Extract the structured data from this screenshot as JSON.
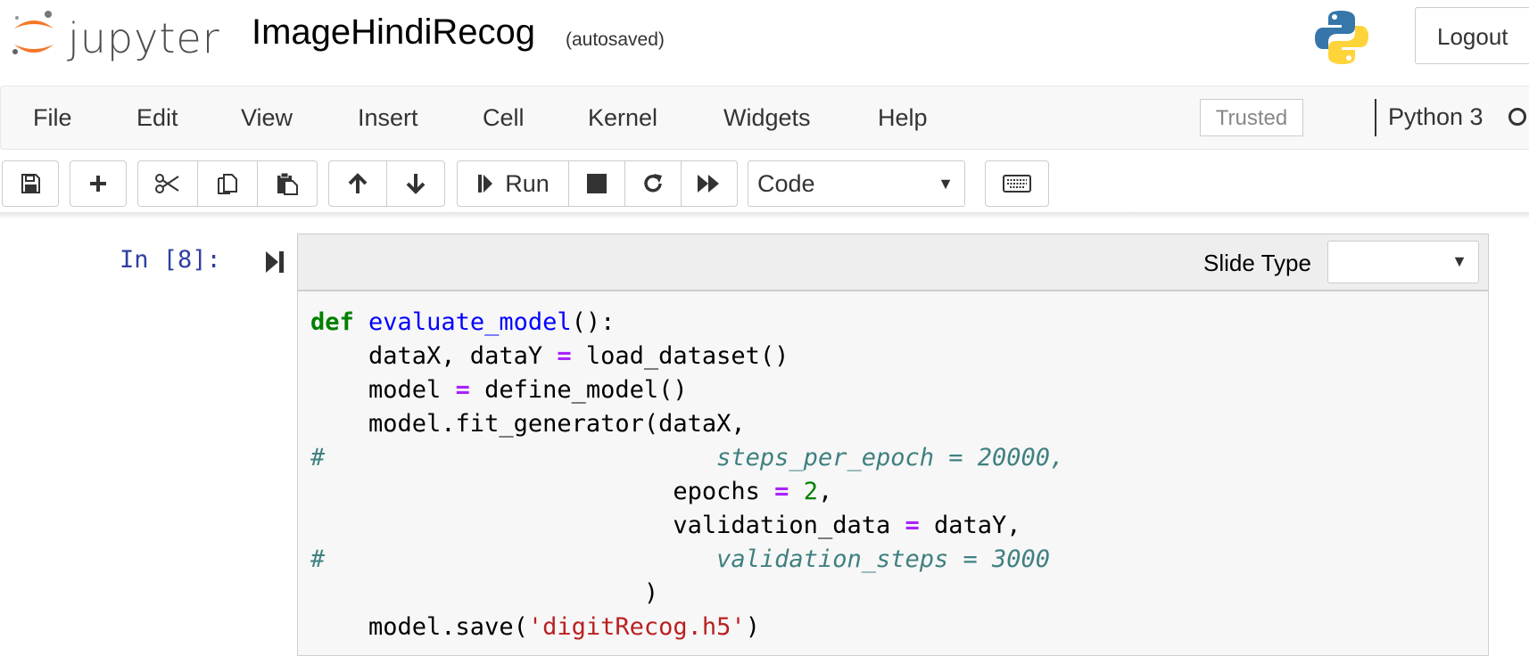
{
  "header": {
    "logo_text": "jupyter",
    "notebook_name": "ImageHindiRecog",
    "save_status": "(autosaved)",
    "logout_label": "Logout"
  },
  "menu": {
    "items": [
      "File",
      "Edit",
      "View",
      "Insert",
      "Cell",
      "Kernel",
      "Widgets",
      "Help"
    ],
    "trusted_label": "Trusted",
    "kernel_name": "Python 3"
  },
  "toolbar": {
    "run_label": "Run",
    "cell_type": "Code"
  },
  "cell": {
    "prompt": "In [8]:",
    "slide_type_label": "Slide Type",
    "slide_type_value": "",
    "code_lines": [
      "def evaluate_model():",
      "    dataX, dataY = load_dataset()",
      "    model = define_model()",
      "    model.fit_generator(dataX,",
      "#                           steps_per_epoch = 20000,",
      "                         epochs = 2,",
      "                         validation_data = dataY,",
      "#                           validation_steps = 3000",
      "                       )",
      "    model.save('digitRecog.h5')"
    ]
  },
  "colors": {
    "keyword": "#008000",
    "function_name": "#0000ff",
    "operator": "#aa22ff",
    "string": "#ba2121",
    "comment": "#408080",
    "prompt": "#303f9f",
    "logo_orange": "#f37726"
  },
  "icons": [
    "save-icon",
    "plus-icon",
    "cut-icon",
    "copy-icon",
    "paste-icon",
    "arrow-up-icon",
    "arrow-down-icon",
    "step-forward-icon",
    "stop-icon",
    "restart-icon",
    "fast-forward-icon",
    "keyboard-icon",
    "python-logo-icon"
  ]
}
